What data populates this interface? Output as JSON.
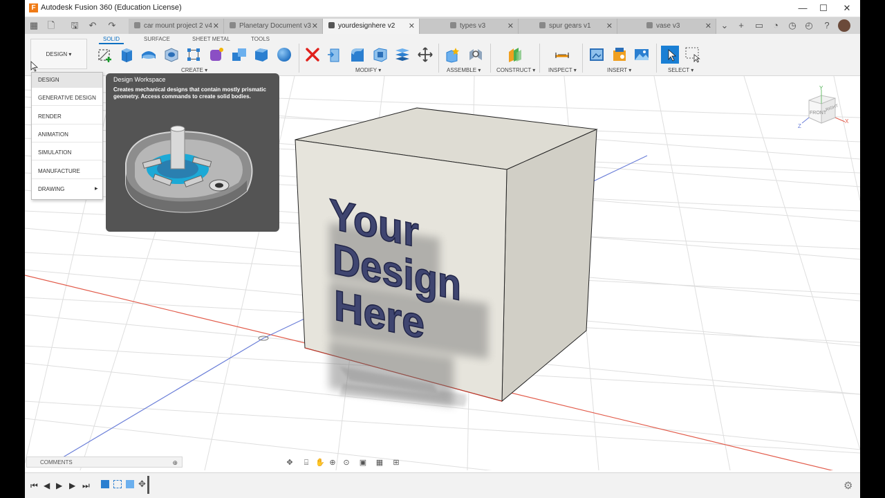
{
  "window": {
    "title": "Autodesk Fusion 360 (Education License)",
    "logo_letter": "F",
    "controls": {
      "minimize": "—",
      "maximize": "☐",
      "close": "✕"
    }
  },
  "tabs": [
    {
      "label": "car mount project 2 v4",
      "active": false
    },
    {
      "label": "Planetary Document v3",
      "active": false
    },
    {
      "label": "yourdesignhere v2",
      "active": true
    },
    {
      "label": "types v3",
      "active": false
    },
    {
      "label": "spur gears v1",
      "active": false
    },
    {
      "label": "vase v3",
      "active": false
    }
  ],
  "toolbar": {
    "workspace_button": "DESIGN ▾",
    "subtabs": [
      "SOLID",
      "SURFACE",
      "SHEET METAL",
      "TOOLS"
    ],
    "groups": [
      "CREATE ▾",
      "MODIFY ▾",
      "ASSEMBLE ▾",
      "CONSTRUCT ▾",
      "INSPECT ▾",
      "INSERT ▾",
      "SELECT ▾"
    ]
  },
  "workspace_menu": {
    "items": [
      "DESIGN",
      "GENERATIVE DESIGN",
      "RENDER",
      "ANIMATION",
      "SIMULATION",
      "MANUFACTURE",
      "DRAWING"
    ],
    "selected": "DESIGN",
    "submenu_arrow": "▸"
  },
  "tooltip": {
    "title": "Design Workspace",
    "description": "Creates mechanical designs that contain mostly prismatic geometry. Access commands to create solid bodies."
  },
  "model": {
    "text_lines": [
      "Your",
      "Design",
      "Here"
    ],
    "text_color": "#3f4570",
    "box_face_color": "#e6e4dc"
  },
  "viewcube": {
    "front": "FRONT",
    "right": "RIGHT",
    "x": "X",
    "y": "Y",
    "z": "Z"
  },
  "comments": {
    "label": "COMMENTS",
    "add": "⊕"
  },
  "colors": {
    "accent": "#0a6fc2",
    "delete": "#e0201b",
    "axis_red": "#e25b4a",
    "axis_blue": "#6a7ed8"
  }
}
